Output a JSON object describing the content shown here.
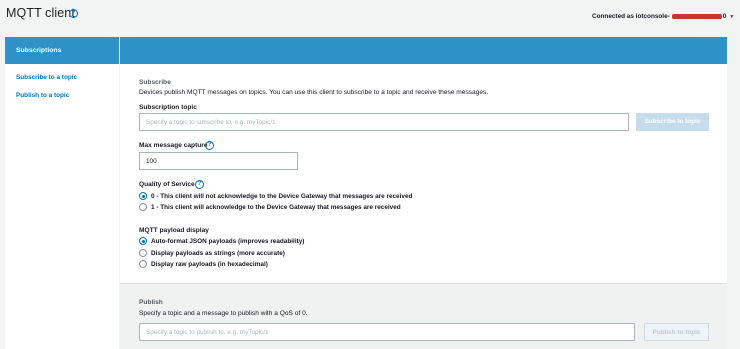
{
  "header": {
    "title": "MQTT client",
    "connection_prefix": "Connected as iotconsole-",
    "connection_suffix": "0"
  },
  "sidebar": {
    "heading": "Subscriptions",
    "items": [
      {
        "label": "Subscribe to a topic"
      },
      {
        "label": "Publish to a topic"
      }
    ]
  },
  "subscribe": {
    "title": "Subscribe",
    "description": "Devices publish MQTT messages on topics. You can use this client to subscribe to a topic and receive these messages.",
    "topic_label": "Subscription topic",
    "topic_placeholder": "Specify a topic to subscribe to, e.g. myTopic/1",
    "button_label": "Subscribe to topic",
    "max_capture_label": "Max message capture",
    "max_capture_value": "100",
    "qos_label": "Quality of Service",
    "qos_options": [
      {
        "label": "0 - This client will not acknowledge to the Device Gateway that messages are received",
        "selected": true
      },
      {
        "label": "1 - This client will acknowledge to the Device Gateway that messages are received",
        "selected": false
      }
    ],
    "payload_label": "MQTT payload display",
    "payload_options": [
      {
        "label": "Auto-format JSON payloads (improves readability)",
        "selected": true
      },
      {
        "label": "Display payloads as strings (more accurate)",
        "selected": false
      },
      {
        "label": "Display raw payloads (in hexadecimal)",
        "selected": false
      }
    ]
  },
  "publish": {
    "title": "Publish",
    "description": "Specify a topic and a message to publish with a QoS of 0.",
    "topic_placeholder": "Specify a topic to publish to, e.g. myTopic/1",
    "button_label": "Publish to topic"
  },
  "colors": {
    "accent": "#2e91c8",
    "link": "#0073bb",
    "disabled_button": "#c5dced"
  }
}
